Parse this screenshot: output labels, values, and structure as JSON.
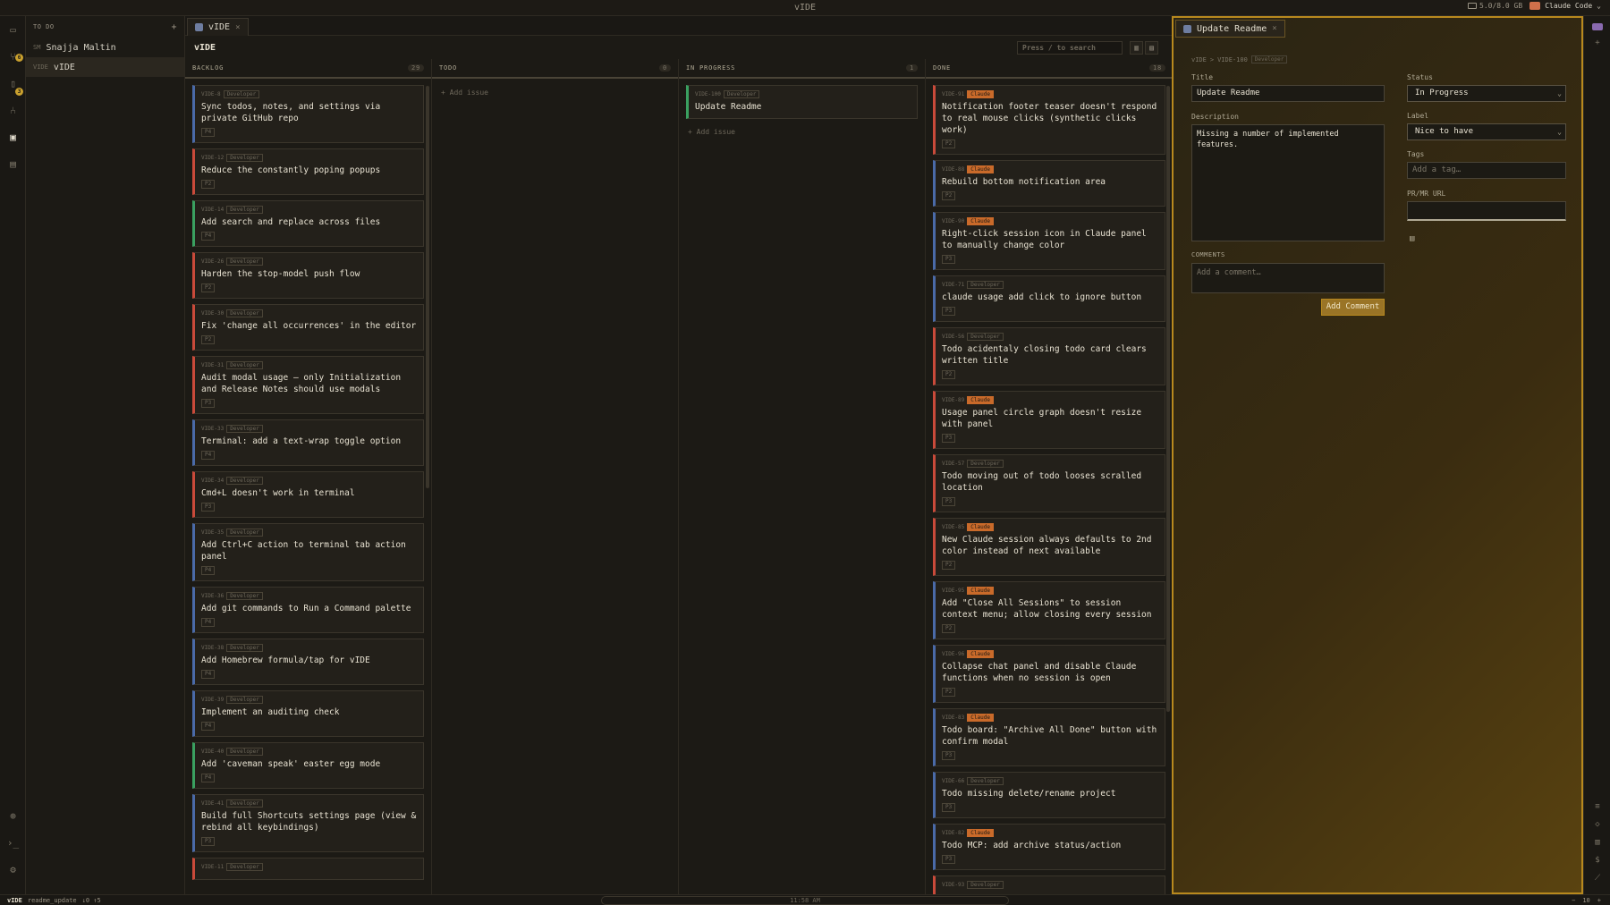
{
  "window": {
    "title": "vIDE",
    "memory": "5.0/8.0 GB",
    "claude_label": "Claude Code"
  },
  "activity": {
    "badges": [
      "6",
      "3"
    ]
  },
  "sidebar": {
    "header": "TO DO",
    "add": "+",
    "items": [
      {
        "prefix": "SM",
        "label": "Snajja Maltin"
      },
      {
        "prefix": "VIDE",
        "label": "vIDE"
      }
    ]
  },
  "board_tab": {
    "label": "vIDE",
    "close": "×"
  },
  "board": {
    "title": "vIDE",
    "search_placeholder": "Press / to search",
    "add_issue": "+ Add issue",
    "columns": [
      {
        "name": "BACKLOG",
        "count": "29"
      },
      {
        "name": "TODO",
        "count": "0"
      },
      {
        "name": "IN PROGRESS",
        "count": "1"
      },
      {
        "name": "DONE",
        "count": "18"
      }
    ],
    "backlog": [
      {
        "id": "VIDE-8",
        "tag": "Developer",
        "title": "Sync todos, notes, and settings via private GitHub repo",
        "prio": "P4",
        "cls": "p4",
        "tagcls": ""
      },
      {
        "id": "VIDE-12",
        "tag": "Developer",
        "title": "Reduce the constantly poping popups",
        "prio": "P2",
        "cls": "p1",
        "tagcls": ""
      },
      {
        "id": "VIDE-14",
        "tag": "Developer",
        "title": "Add search and replace across files",
        "prio": "P4",
        "cls": "p2",
        "tagcls": ""
      },
      {
        "id": "VIDE-26",
        "tag": "Developer",
        "title": "Harden the stop-model push flow",
        "prio": "P2",
        "cls": "p1",
        "tagcls": ""
      },
      {
        "id": "VIDE-30",
        "tag": "Developer",
        "title": "Fix 'change all occurrences' in the editor",
        "prio": "P2",
        "cls": "p1",
        "tagcls": ""
      },
      {
        "id": "VIDE-31",
        "tag": "Developer",
        "title": "Audit modal usage — only Initialization and Release Notes should use modals",
        "prio": "P3",
        "cls": "p1",
        "tagcls": ""
      },
      {
        "id": "VIDE-33",
        "tag": "Developer",
        "title": "Terminal: add a text-wrap toggle option",
        "prio": "P4",
        "cls": "p3",
        "tagcls": ""
      },
      {
        "id": "VIDE-34",
        "tag": "Developer",
        "title": "Cmd+L doesn't work in terminal",
        "prio": "P3",
        "cls": "p1",
        "tagcls": ""
      },
      {
        "id": "VIDE-35",
        "tag": "Developer",
        "title": "Add Ctrl+C action to terminal tab action panel",
        "prio": "P4",
        "cls": "p3",
        "tagcls": ""
      },
      {
        "id": "VIDE-36",
        "tag": "Developer",
        "title": "Add git commands to Run a Command palette",
        "prio": "P4",
        "cls": "p3",
        "tagcls": ""
      },
      {
        "id": "VIDE-38",
        "tag": "Developer",
        "title": "Add Homebrew formula/tap for vIDE",
        "prio": "P4",
        "cls": "p3",
        "tagcls": ""
      },
      {
        "id": "VIDE-39",
        "tag": "Developer",
        "title": "Implement an auditing check",
        "prio": "P4",
        "cls": "p3",
        "tagcls": ""
      },
      {
        "id": "VIDE-40",
        "tag": "Developer",
        "title": "Add 'caveman speak' easter egg mode",
        "prio": "P4",
        "cls": "p2",
        "tagcls": ""
      },
      {
        "id": "VIDE-41",
        "tag": "Developer",
        "title": "Build full Shortcuts settings page (view & rebind all keybindings)",
        "prio": "P3",
        "cls": "p3",
        "tagcls": ""
      },
      {
        "id": "VIDE-11",
        "tag": "Developer",
        "title": "",
        "prio": "",
        "cls": "p1",
        "tagcls": ""
      }
    ],
    "inprogress": [
      {
        "id": "VIDE-100",
        "tag": "Developer",
        "title": "Update Readme",
        "prio": "",
        "cls": "p2",
        "tagcls": ""
      }
    ],
    "done": [
      {
        "id": "VIDE-91",
        "tag": "Claude",
        "title": "Notification footer teaser doesn't respond to real mouse clicks (synthetic clicks work)",
        "prio": "P2",
        "cls": "p1",
        "tagcls": "claude"
      },
      {
        "id": "VIDE-88",
        "tag": "Claude",
        "title": "Rebuild bottom notification area",
        "prio": "P2",
        "cls": "p3",
        "tagcls": "claude"
      },
      {
        "id": "VIDE-90",
        "tag": "Claude",
        "title": "Right-click session icon in Claude panel to manually change color",
        "prio": "P3",
        "cls": "p3",
        "tagcls": "claude"
      },
      {
        "id": "VIDE-71",
        "tag": "Developer",
        "title": "claude usage add click to ignore button",
        "prio": "P3",
        "cls": "p3",
        "tagcls": ""
      },
      {
        "id": "VIDE-56",
        "tag": "Developer",
        "title": "Todo acidentaly closing todo card clears written title",
        "prio": "P2",
        "cls": "p1",
        "tagcls": ""
      },
      {
        "id": "VIDE-89",
        "tag": "Claude",
        "title": "Usage panel circle graph doesn't resize with panel",
        "prio": "P3",
        "cls": "p1",
        "tagcls": "claude"
      },
      {
        "id": "VIDE-57",
        "tag": "Developer",
        "title": "Todo moving out of todo looses scralled location",
        "prio": "P3",
        "cls": "p1",
        "tagcls": ""
      },
      {
        "id": "VIDE-85",
        "tag": "Claude",
        "title": "New Claude session always defaults to 2nd color instead of next available",
        "prio": "P2",
        "cls": "p1",
        "tagcls": "claude"
      },
      {
        "id": "VIDE-95",
        "tag": "Claude",
        "title": "Add \"Close All Sessions\" to session context menu; allow closing every session",
        "prio": "P2",
        "cls": "p3",
        "tagcls": "claude"
      },
      {
        "id": "VIDE-96",
        "tag": "Claude",
        "title": "Collapse chat panel and disable Claude functions when no session is open",
        "prio": "P2",
        "cls": "p3",
        "tagcls": "claude"
      },
      {
        "id": "VIDE-83",
        "tag": "Claude",
        "title": "Todo board: \"Archive All Done\" button with confirm modal",
        "prio": "P3",
        "cls": "p3",
        "tagcls": "claude"
      },
      {
        "id": "VIDE-66",
        "tag": "Developer",
        "title": "Todo missing delete/rename project",
        "prio": "P3",
        "cls": "p3",
        "tagcls": ""
      },
      {
        "id": "VIDE-82",
        "tag": "Claude",
        "title": "Todo MCP: add archive status/action",
        "prio": "P3",
        "cls": "p3",
        "tagcls": "claude"
      },
      {
        "id": "VIDE-93",
        "tag": "Developer",
        "title": "",
        "prio": "",
        "cls": "p1",
        "tagcls": ""
      }
    ]
  },
  "detail": {
    "tab_label": "Update Readme",
    "tab_close": "×",
    "crumb_project": "vIDE",
    "crumb_sep": ">",
    "crumb_id": "VIDE-100",
    "crumb_tag": "Developer",
    "title_label": "Title",
    "title_value": "Update Readme",
    "desc_label": "Description",
    "desc_value": "Missing a number of implemented features.",
    "comments_label": "COMMENTS",
    "comment_placeholder": "Add a comment…",
    "add_comment": "Add Comment",
    "status_label": "Status",
    "status_value": "In Progress",
    "label_label": "Label",
    "label_value": "Nice to have",
    "tags_label": "Tags",
    "tags_placeholder": "Add a tag…",
    "pr_label": "PR/MR URL",
    "pr_value": ""
  },
  "statusbar": {
    "project": "vIDE",
    "branch": "readme_update",
    "changes": "↓0 ↑5",
    "time": "11:58 AM",
    "zoom": "10"
  }
}
